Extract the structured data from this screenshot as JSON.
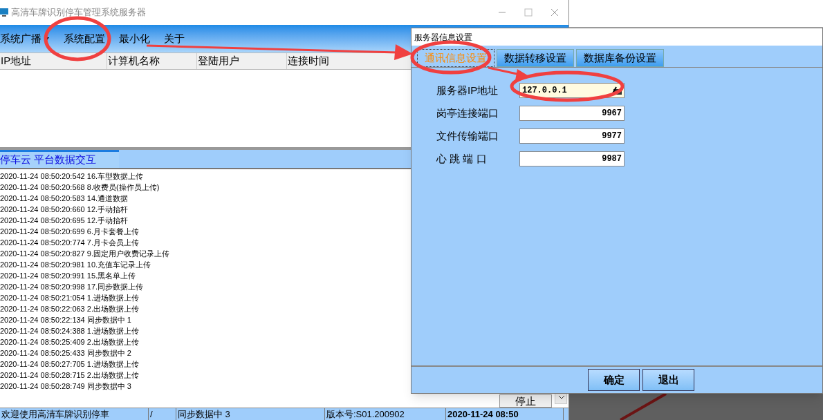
{
  "main_window": {
    "title": "高清车牌识别停车管理系统服务器",
    "menu": [
      {
        "label": "系统广播",
        "dropdown": true
      },
      {
        "label": "系统配置",
        "dropdown": false
      },
      {
        "label": "最小化",
        "dropdown": false
      },
      {
        "label": "关于",
        "dropdown": false
      }
    ],
    "table": {
      "columns": [
        "IP地址",
        "计算机名称",
        "登陆用户",
        "连接时间"
      ]
    },
    "tabs": [
      {
        "label": "停车云 平台数据交互",
        "selected": true
      }
    ],
    "log": [
      "2020-11-24 08:50:20:542 16.车型数据上传",
      "2020-11-24 08:50:20:568 8.收费员(操作员上传)",
      "2020-11-24 08:50:20:583 14.通道数据",
      "2020-11-24 08:50:20:660 12.手动抬杆",
      "2020-11-24 08:50:20:695 12.手动抬杆",
      "2020-11-24 08:50:20:699 6.月卡套餐上传",
      "2020-11-24 08:50:20:774 7.月卡会员上传",
      "2020-11-24 08:50:20:827 9.固定用户收费记录上传",
      "2020-11-24 08:50:20:981 10.充值车记录上传",
      "2020-11-24 08:50:20:991 15.黑名单上传",
      "2020-11-24 08:50:20:998 17.同步数据上传",
      "2020-11-24 08:50:21:054 1.进场数据上传",
      "2020-11-24 08:50:22:063 2.出场数据上传",
      "2020-11-24 08:50:22:134 同步数据中 1",
      "2020-11-24 08:50:24:388 1.进场数据上传",
      "2020-11-24 08:50:25:409 2.出场数据上传",
      "2020-11-24 08:50:25:433 同步数据中 2",
      "2020-11-24 08:50:27:705 1.进场数据上传",
      "2020-11-24 08:50:28:715 2.出场数据上传",
      "2020-11-24 08:50:28:749 同步数据中 3"
    ],
    "stop_button": "停止",
    "status_bar": [
      {
        "text": "欢迎使用高清车牌识别停車",
        "emphasis": false
      },
      {
        "text": "/",
        "emphasis": false
      },
      {
        "text": "同步数据中 3",
        "emphasis": false
      },
      {
        "text": "版本号:S01.200902",
        "emphasis": false
      },
      {
        "text": "2020-11-24 08:50",
        "emphasis": true
      }
    ]
  },
  "dialog": {
    "title": "服务器信息设置",
    "tabs": [
      {
        "label": "通讯信息设置",
        "selected": true
      },
      {
        "label": "数据转移设置",
        "selected": false
      },
      {
        "label": "数据库备份设置",
        "selected": false
      }
    ],
    "fields": [
      {
        "label": "服务器IP地址",
        "value": "127.0.0.1",
        "kind": "address"
      },
      {
        "label": "岗亭连接端口",
        "value": "9967",
        "kind": "number"
      },
      {
        "label": "文件传输端口",
        "value": "9977",
        "kind": "number"
      },
      {
        "label": "心 跳 端 口",
        "value": "9987",
        "kind": "number"
      }
    ],
    "buttons": [
      "确定",
      "退出"
    ]
  }
}
